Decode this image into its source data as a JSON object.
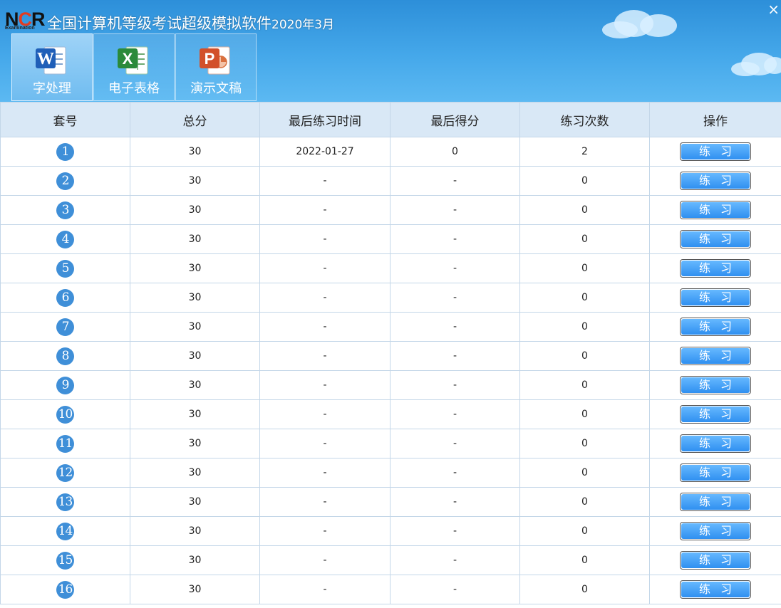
{
  "app": {
    "logo_big_n": "N",
    "logo_big_c": "C",
    "logo_big_r": "R",
    "logo_small": "Examination",
    "title": "全国计算机等级考试超级模拟软件",
    "title_suffix": "2020年3月",
    "close_symbol": "×"
  },
  "tabs": [
    {
      "label": "字处理",
      "icon": "word-icon",
      "active": true
    },
    {
      "label": "电子表格",
      "icon": "excel-icon",
      "active": false
    },
    {
      "label": "演示文稿",
      "icon": "powerpoint-icon",
      "active": false
    }
  ],
  "table": {
    "headers": [
      "套号",
      "总分",
      "最后练习时间",
      "最后得分",
      "练习次数",
      "操作"
    ],
    "action_label": "练习",
    "rows": [
      {
        "no": "1",
        "total": "30",
        "last_time": "2022-01-27",
        "last_score": "0",
        "count": "2"
      },
      {
        "no": "2",
        "total": "30",
        "last_time": "-",
        "last_score": "-",
        "count": "0"
      },
      {
        "no": "3",
        "total": "30",
        "last_time": "-",
        "last_score": "-",
        "count": "0"
      },
      {
        "no": "4",
        "total": "30",
        "last_time": "-",
        "last_score": "-",
        "count": "0"
      },
      {
        "no": "5",
        "total": "30",
        "last_time": "-",
        "last_score": "-",
        "count": "0"
      },
      {
        "no": "6",
        "total": "30",
        "last_time": "-",
        "last_score": "-",
        "count": "0"
      },
      {
        "no": "7",
        "total": "30",
        "last_time": "-",
        "last_score": "-",
        "count": "0"
      },
      {
        "no": "8",
        "total": "30",
        "last_time": "-",
        "last_score": "-",
        "count": "0"
      },
      {
        "no": "9",
        "total": "30",
        "last_time": "-",
        "last_score": "-",
        "count": "0"
      },
      {
        "no": "10",
        "total": "30",
        "last_time": "-",
        "last_score": "-",
        "count": "0"
      },
      {
        "no": "11",
        "total": "30",
        "last_time": "-",
        "last_score": "-",
        "count": "0"
      },
      {
        "no": "12",
        "total": "30",
        "last_time": "-",
        "last_score": "-",
        "count": "0"
      },
      {
        "no": "13",
        "total": "30",
        "last_time": "-",
        "last_score": "-",
        "count": "0"
      },
      {
        "no": "14",
        "total": "30",
        "last_time": "-",
        "last_score": "-",
        "count": "0"
      },
      {
        "no": "15",
        "total": "30",
        "last_time": "-",
        "last_score": "-",
        "count": "0"
      },
      {
        "no": "16",
        "total": "30",
        "last_time": "-",
        "last_score": "-",
        "count": "0"
      }
    ]
  },
  "colors": {
    "header_blue": "#45a8ea",
    "table_header_bg": "#d9e8f6",
    "badge_blue": "#3f8fd8",
    "button_blue": "#2f8ff0"
  }
}
